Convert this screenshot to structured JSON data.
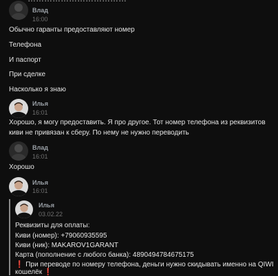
{
  "header_fragment": "………………………………",
  "messages": [
    {
      "author": "Влад",
      "time": "16:00",
      "lines": [
        "Обычно гаранты предоставляют номер",
        "Телефона",
        "И паспорт",
        "При сделке",
        "Насколько я знаю"
      ]
    },
    {
      "author": "Илья",
      "time": "16:01",
      "lines": [
        "Хорошо, я могу предоставить. Я про другое. Тот номер телефона из реквизитов",
        "киви не привязан к сберу. По нему не нужно переводить"
      ]
    },
    {
      "author": "Влад",
      "time": "16:01",
      "lines": [
        "Хорошо"
      ]
    },
    {
      "author": "Илья",
      "time": "16:01",
      "lines": []
    }
  ],
  "quoted": {
    "author": "Илья",
    "time": "03.02.22",
    "lines": [
      "Реквизиты для оплаты:",
      "Киви (номер): +79060935595",
      "Киви (ник): MAKAROV1GARANT",
      "Карта (пополнение с любого банка): 4890494784675175",
      "При переводе по номеру телефона, деньги нужно скидывать именно на QIWI",
      "кошелёк"
    ],
    "warning_emoji": "❗"
  },
  "colors": {
    "background": "#0e0e0e",
    "text": "#e6e6e6",
    "author": "#9aa0a6",
    "time": "#6f6f6f",
    "warning": "#e53935"
  }
}
